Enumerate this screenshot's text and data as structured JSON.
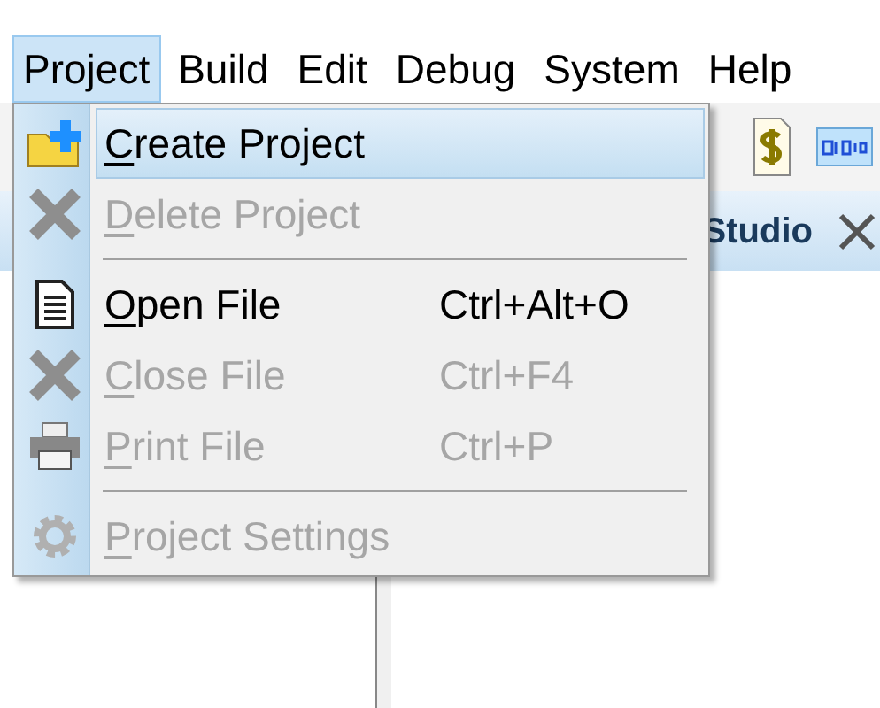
{
  "menu_bar": [
    {
      "label": "Project",
      "selected": true
    },
    {
      "label": "Build",
      "selected": false
    },
    {
      "label": "Edit",
      "selected": false
    },
    {
      "label": "Debug",
      "selected": false
    },
    {
      "label": "System",
      "selected": false
    },
    {
      "label": "Help",
      "selected": false
    }
  ],
  "document_tab": {
    "label": "Studio"
  },
  "project_menu": [
    {
      "kind": "command",
      "label": "Create Project",
      "disabled": false,
      "selected": true
    },
    {
      "kind": "command",
      "label": "Delete Project",
      "disabled": true,
      "selected": false
    },
    {
      "kind": "separator"
    },
    {
      "kind": "command",
      "label": "Open File",
      "shortcut": "Ctrl+Alt+O",
      "disabled": false,
      "selected": false
    },
    {
      "kind": "command",
      "label": "Close File",
      "shortcut": "Ctrl+F4",
      "disabled": true,
      "selected": false
    },
    {
      "kind": "command",
      "label": "Print File",
      "shortcut": "Ctrl+P",
      "disabled": true,
      "selected": false
    },
    {
      "kind": "separator"
    },
    {
      "kind": "command",
      "label": "Project Settings",
      "disabled": true,
      "selected": false
    }
  ]
}
